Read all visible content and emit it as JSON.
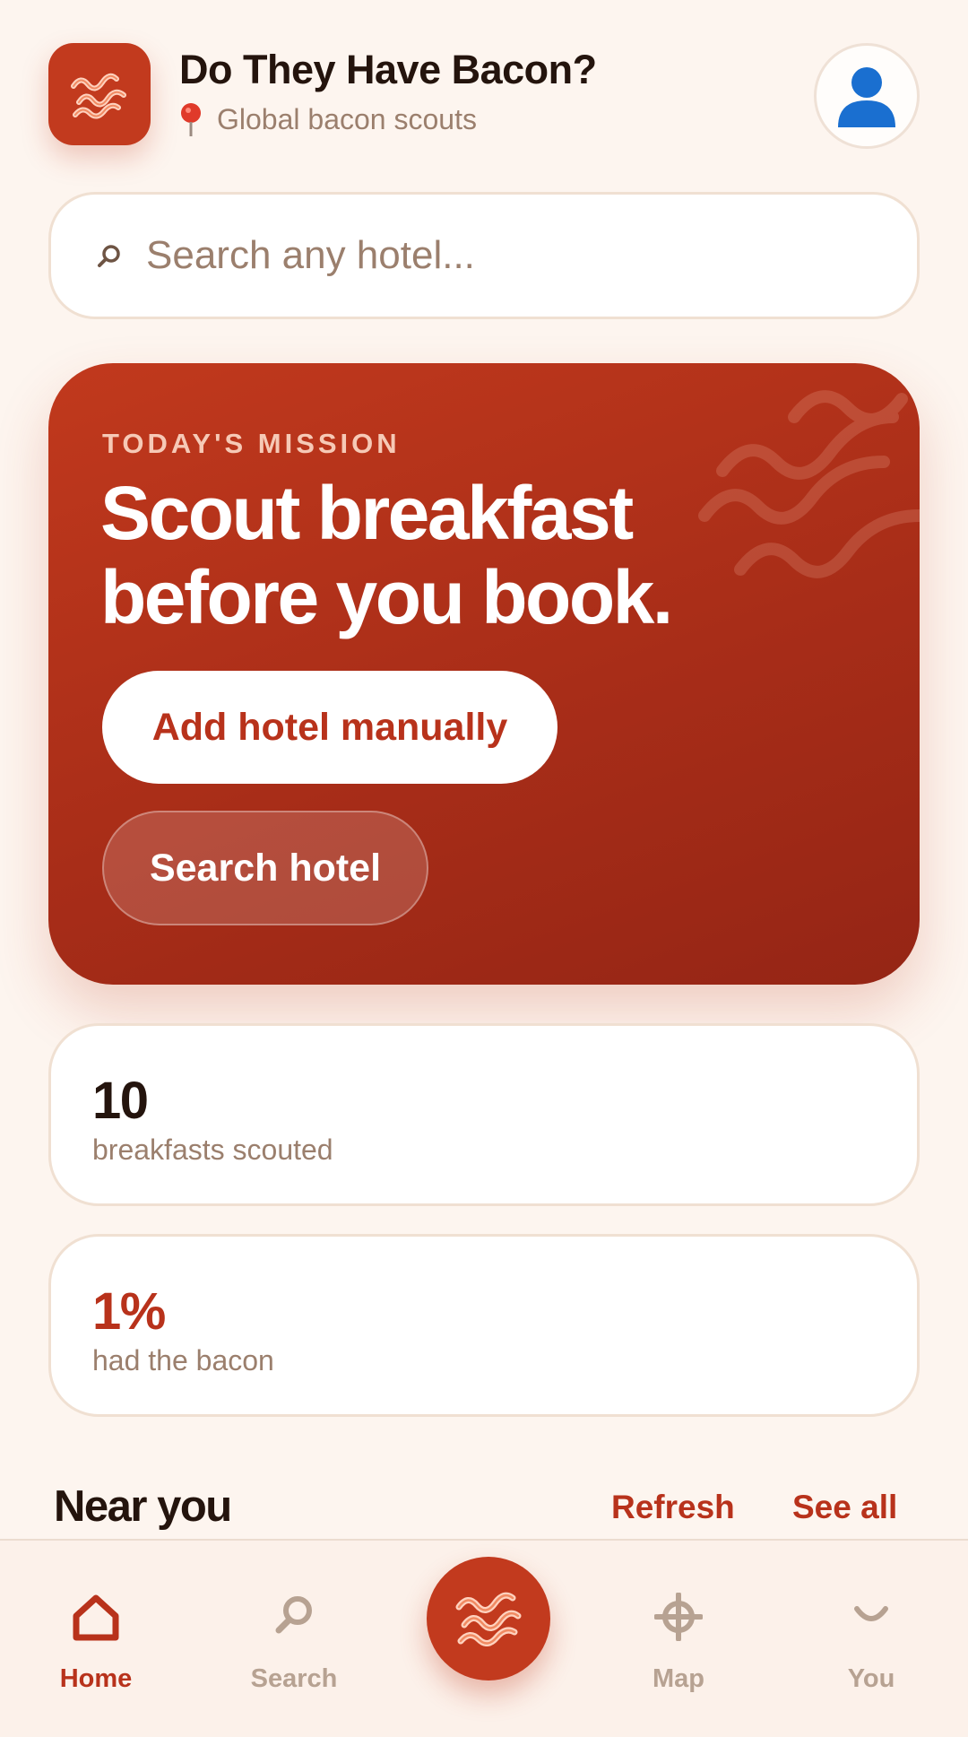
{
  "header": {
    "title": "Do They Have Bacon?",
    "subtitle": "Global bacon scouts",
    "logo_icon": "bacon-icon",
    "avatar_icon": "user-silhouette-icon"
  },
  "search": {
    "placeholder": "Search any hotel..."
  },
  "hero": {
    "kicker": "TODAY'S MISSION",
    "headline_line1": "Scout breakfast",
    "headline_line2": "before you book.",
    "primary_button": "Add hotel manually",
    "secondary_button": "Search hotel"
  },
  "stats": [
    {
      "value": "10",
      "label": "breakfasts scouted"
    },
    {
      "value": "1%",
      "label": "had the bacon"
    }
  ],
  "near_you": {
    "title": "Near you",
    "refresh": "Refresh",
    "see_all": "See all"
  },
  "nav": {
    "items": [
      {
        "label": "Home",
        "icon": "home-icon",
        "active": true
      },
      {
        "label": "Search",
        "icon": "search-icon",
        "active": false
      },
      {
        "label": "Map",
        "icon": "crosshair-icon",
        "active": false
      },
      {
        "label": "You",
        "icon": "user-icon",
        "active": false
      }
    ],
    "fab_icon": "bacon-icon"
  },
  "colors": {
    "accent": "#c23a1e",
    "background": "#fdf5ef",
    "muted_text": "#9b7f6d"
  }
}
